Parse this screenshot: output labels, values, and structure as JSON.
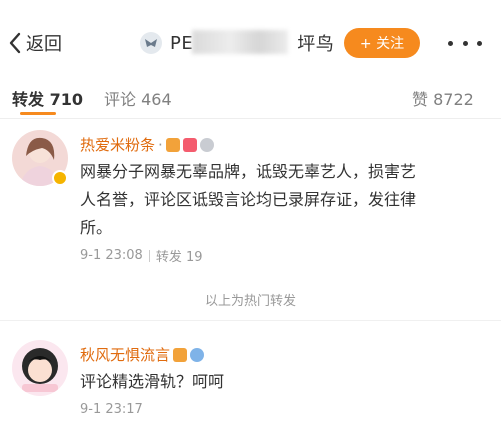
{
  "header": {
    "back_label": "返回",
    "title_left": "PE",
    "title_right": "坪鸟",
    "follow_label": "+ 关注"
  },
  "tabs": {
    "repost": "转发 710",
    "comment": "评论 464",
    "like": "赞 8722"
  },
  "reposts": [
    {
      "username": "热爱米粉条",
      "separator": "·",
      "text_lines": [
        "网暴分子网暴无辜品牌，诋毁无辜艺人，损害艺",
        "人名誉，评论区诋毁言论均已录屏存证，发往律",
        "所。"
      ],
      "time": "9-1 23:08",
      "action": "转发 19"
    },
    {
      "username": "秋风无惧流言",
      "text_lines": [
        "评论精选滑轨？呵呵"
      ],
      "time": "9-1 23:17"
    }
  ],
  "hot_label": "以上为热门转发",
  "colors": {
    "accent": "#f68a1e",
    "username": "#e06b0e"
  }
}
